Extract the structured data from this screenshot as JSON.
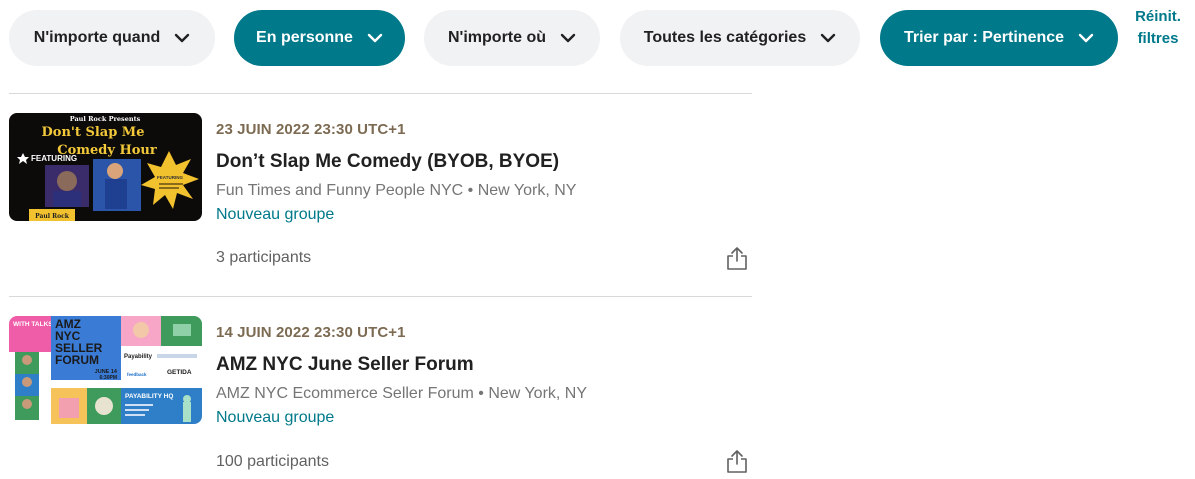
{
  "filters": {
    "when": "N'importe quand",
    "type": "En personne",
    "where": "N'importe où",
    "category": "Toutes les catégories",
    "sort": "Trier par : Pertinence",
    "reset_line1": "Réinit.",
    "reset_line2": "filtres"
  },
  "colors": {
    "accent": "#00798a",
    "pill_bg": "#f1f2f4",
    "date": "#7c6b52"
  },
  "events": [
    {
      "date": "23 JUIN 2022 23:30 UTC+1",
      "title": "Don’t Slap Me Comedy (BYOB, BYOE)",
      "group": "Fun Times and Funny People NYC • New York, NY",
      "new_group": "Nouveau groupe",
      "attendees": "3 participants",
      "thumb": {
        "presenter": "Paul Rock Presents",
        "title1": "Don't Slap Me",
        "title2": "Comedy Hour",
        "featuring": "FEATURING",
        "name": "Paul Rock",
        "burst": "FEATURING"
      }
    },
    {
      "date": "14 JUIN 2022 23:30 UTC+1",
      "title": "AMZ NYC June Seller Forum",
      "group": "AMZ NYC Ecommerce Seller Forum • New York, NY",
      "new_group": "Nouveau groupe",
      "attendees": "100 participants",
      "thumb": {
        "with_talks": "WITH TALKS FROM:",
        "amz": "AMZ",
        "nyc": "NYC",
        "seller": "SELLER",
        "forum": "FORUM",
        "date": "JUNE 14",
        "time": "6:30PM",
        "sponsor1": "Payability",
        "sponsor2": "GETIDA",
        "sponsor3": "feedback",
        "hq": "PAYABILITY HQ"
      }
    }
  ]
}
